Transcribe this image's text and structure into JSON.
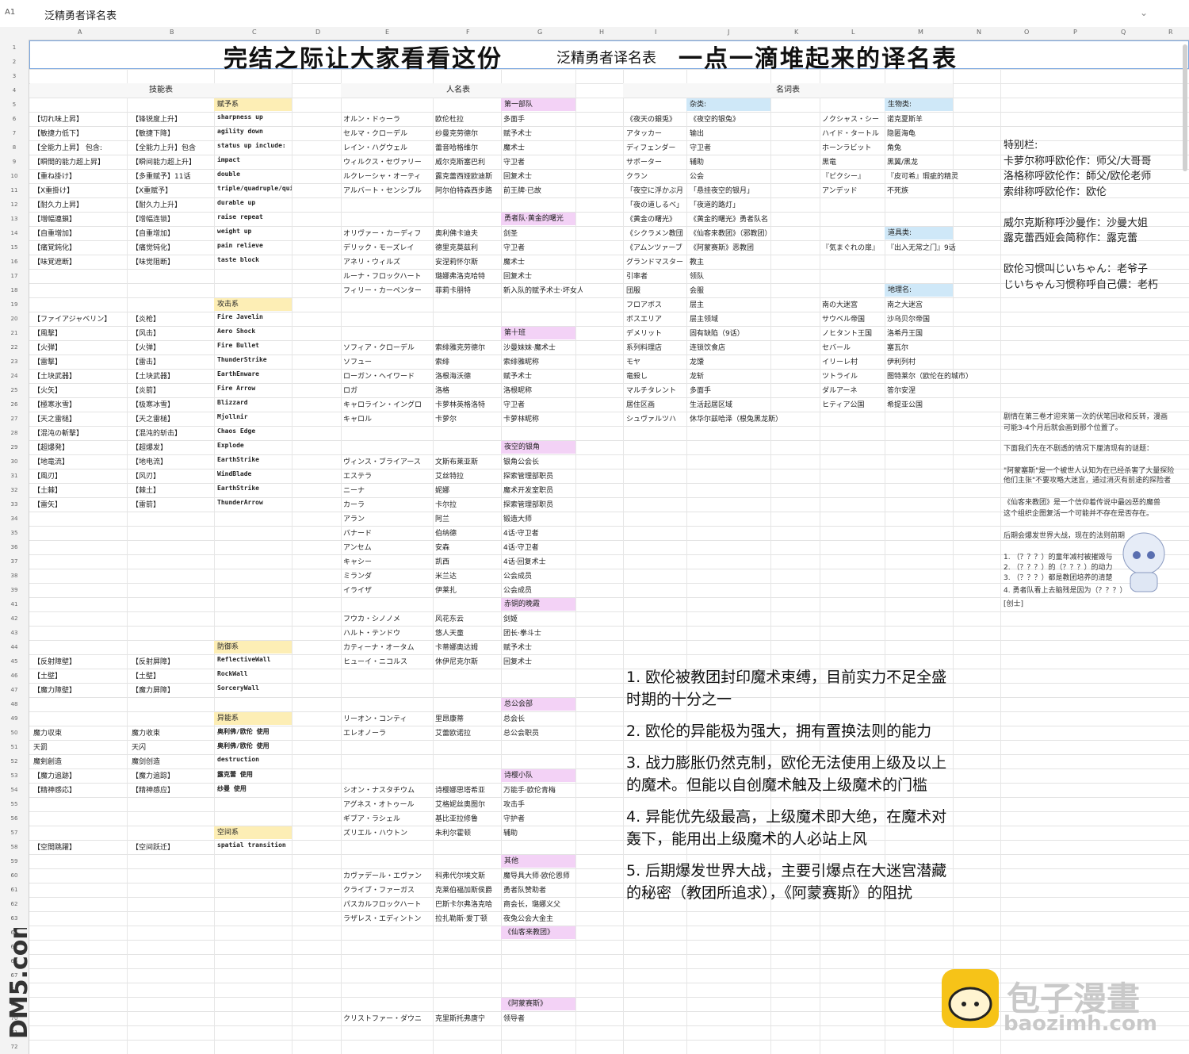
{
  "formula": {
    "cell_ref": "A1",
    "content": "泛精勇者译名表",
    "collapse_icon": "chevron-down-icon"
  },
  "columns": [
    "A",
    "",
    "B",
    "C",
    "D",
    "E",
    "F",
    "G",
    "H",
    "I",
    "J",
    "K",
    "L",
    "M",
    "N",
    "O",
    "P",
    "Q",
    "R"
  ],
  "rows": [
    "1",
    "2",
    "3",
    "4",
    "5",
    "6",
    "7",
    "8",
    "9",
    "10",
    "11",
    "12",
    "13",
    "14",
    "15",
    "16",
    "17",
    "18",
    "19",
    "20",
    "21",
    "22",
    "23",
    "24",
    "25",
    "26",
    "27",
    "28",
    "29",
    "30",
    "31",
    "32",
    "33",
    "34",
    "35",
    "36",
    "37",
    "38",
    "39",
    "41",
    "42",
    "43",
    "44",
    "45",
    "46",
    "47",
    "48",
    "49",
    "50",
    "51",
    "52",
    "53",
    "54",
    "55",
    "56",
    "57",
    "58",
    "59",
    "60",
    "61",
    "62",
    "63",
    "64",
    "65",
    "66",
    "67",
    "68",
    "69",
    "70",
    "71",
    "72"
  ],
  "title": {
    "left": "完结之际让大家看看这份",
    "mid": "泛精勇者译名表",
    "right": "一点一滴堆起来的译名表"
  },
  "sections": {
    "skills": "技能表",
    "names": "人名表",
    "terms": "名词表"
  },
  "skill_groups": {
    "fuyo": "赋予系",
    "attack": "攻击系",
    "defense": "防御系",
    "ability": "异能系",
    "space": "空间系"
  },
  "skills_fuyo": [
    [
      "【切れ味上昇】",
      "【锋锐度上升】",
      "sharpness up"
    ],
    [
      "【敏捷力低下】",
      "【敏捷下降】",
      "agility down"
    ],
    [
      "【全能力上昇】 包含:",
      "【全能力上升】包含",
      "status up include:"
    ],
    [
      "【瞬間的能力超上昇】",
      "【瞬间能力超上升】",
      "impact"
    ],
    [
      "【重ね掛け】",
      "【多重赋予】11话",
      "double"
    ],
    [
      "【X重掛け】",
      "【X重赋予】",
      "triple/quadruple/quintuple"
    ],
    [
      "【耐久力上昇】",
      "【耐久力上升】",
      "durable up"
    ],
    [
      "【増幅連鎖】",
      "【增幅连锁】",
      "raise repeat"
    ],
    [
      "【自重増加】",
      "【自重增加】",
      "weight up"
    ],
    [
      "【痛覚鈍化】",
      "【痛觉钝化】",
      "pain relieve"
    ],
    [
      "【味覚遮断】",
      "【味觉阻断】",
      "taste block"
    ]
  ],
  "skills_attack": [
    [
      "【ファイアジャベリン】",
      "【炎枪】",
      "Fire Javelin"
    ],
    [
      "【風撃】",
      "【风击】",
      "Aero Shock"
    ],
    [
      "【火弾】",
      "【火弹】",
      "Fire Bullet"
    ],
    [
      "【雷撃】",
      "【雷击】",
      "ThunderStrike"
    ],
    [
      "【土块武器】",
      "【土块武器】",
      "EarthEnware"
    ],
    [
      "【火矢】",
      "【炎箭】",
      "Fire Arrow"
    ],
    [
      "【極寒氷雪】",
      "【极寒冰雪】",
      "Blizzard"
    ],
    [
      "【天之雷槌】",
      "【天之雷槌】",
      "Mjollnir"
    ],
    [
      "【混沌の斬撃】",
      "【混沌的斩击】",
      "Chaos Edge"
    ],
    [
      "【超爆発】",
      "【超爆发】",
      "Explode"
    ],
    [
      "【地竜流】",
      "【地电流】",
      "EarthStrike"
    ],
    [
      "【風刃】",
      "【风刃】",
      "WindBlade"
    ],
    [
      "【土棘】",
      "【棘土】",
      "EarthStrike"
    ],
    [
      "【雷矢】",
      "【雷箭】",
      "ThunderArrow"
    ]
  ],
  "skills_defense": [
    [
      "【反射障壁】",
      "【反射屏障】",
      "ReflectiveWall"
    ],
    [
      "【土壁】",
      "【土壁】",
      "RockWall"
    ],
    [
      "【魔力障壁】",
      "【魔力屏障】",
      "SorceryWall"
    ]
  ],
  "skills_ability": [
    [
      "魔力収束",
      "魔力收束",
      "奥利佛/欧伦 使用"
    ],
    [
      "天罰",
      "天闪",
      "奥利佛/欧伦 使用"
    ],
    [
      "魔剣創造",
      "魔剑创造",
      "destruction"
    ],
    [
      "【魔力追跡】",
      "【魔力追踪】",
      "露克蕾 使用"
    ],
    [
      "【精神感応】",
      "【精神感应】",
      "纱曼 使用"
    ]
  ],
  "skills_space": [
    [
      "【空間跳躍】",
      "【空间跃迁】",
      "spatial transition"
    ]
  ],
  "name_groups": {
    "part1": "第一部队",
    "dawn": "勇者队·黄金的曙光",
    "ten": "第十班",
    "night": "夜空的银角",
    "red": "赤铜的晚霞",
    "hq": "总公会部",
    "poem": "诗樱小队",
    "other": "其他",
    "sect": "《仙客来教团》",
    "amon": "《阿蒙赛斯》"
  },
  "names_part1": [
    [
      "オルン・ドゥーラ",
      "欧伦杜拉",
      "多面手"
    ],
    [
      "セルマ・クローデル",
      "纱曼克劳德尔",
      "赋予术士"
    ],
    [
      "レイン・ハグウェル",
      "蕾音哈格维尔",
      "魔术士"
    ],
    [
      "ウィルクス・セヴァリー",
      "威尔克斯塞巴利",
      "守卫者"
    ],
    [
      "ルクレーシャ・オーティ",
      "露克蕾西娅欧迪斯",
      "回复术士"
    ],
    [
      "アルバート・センシブル",
      "阿尔伯特森西步路",
      "前王牌·已故"
    ]
  ],
  "names_dawn": [
    [
      "オリヴァー・カーディフ",
      "奥利佛卡迪夫",
      "剑圣"
    ],
    [
      "デリック・モーズレイ",
      "德里克莫兹利",
      "守卫者"
    ],
    [
      "アネリ・ウィルズ",
      "安涅莉怀尔斯",
      "魔术士"
    ],
    [
      "ルーナ・フロックハート",
      "璐娜弗洛克哈特",
      "回复术士"
    ],
    [
      "フィリー・カーペンター",
      "菲莉卡朋特",
      "新入队的赋予术士·坏女人"
    ]
  ],
  "names_ten": [
    [
      "ソフィア・クローデル",
      "索绯雅克劳德尔",
      "沙曼妹妹·魔术士"
    ],
    [
      "ソフュー",
      "索绯",
      "索绯雅昵称"
    ],
    [
      "ローガン・ヘイワード",
      "洛根海沃德",
      "赋予术士"
    ],
    [
      "ロガ",
      "洛格",
      "洛根昵称"
    ],
    [
      "キャロライン・イングロ",
      "卡萝林英格洛特",
      "守卫者"
    ],
    [
      "キャロル",
      "卡萝尔",
      "卡萝林昵称"
    ]
  ],
  "names_night": [
    [
      "ヴィンス・ブライアース",
      "文斯布莱亚斯",
      "银角公会长"
    ],
    [
      "エステラ",
      "艾丝特拉",
      "探索管理部职员"
    ],
    [
      "ニーナ",
      "妮娜",
      "魔术开发室职员"
    ],
    [
      "カーラ",
      "卡尔拉",
      "探索管理部职员"
    ],
    [
      "アラン",
      "阿兰",
      "锻造大师"
    ],
    [
      "バナード",
      "伯纳德",
      "4话·守卫者"
    ],
    [
      "アンセム",
      "安森",
      "4话·守卫者"
    ],
    [
      "キャシー",
      "凯西",
      "4话·回复术士"
    ],
    [
      "ミランダ",
      "米兰达",
      "公会成员"
    ],
    [
      "イライザ",
      "伊莱扎",
      "公会成员"
    ]
  ],
  "names_red": [
    [
      "フウカ・シノノメ",
      "风花东云",
      "剑姬"
    ],
    [
      "ハルト・テンドウ",
      "悠人天童",
      "团长·拳斗士"
    ],
    [
      "カティーナ・オータム",
      "卡蒂娜奥达姆",
      "赋予术士"
    ],
    [
      "ヒューイ・ニコルス",
      "休伊尼克尔斯",
      "回复术士"
    ]
  ],
  "names_hq": [
    [
      "リーオン・コンティ",
      "里昂康蒂",
      "总会长"
    ],
    [
      "エレオノーラ",
      "艾蕾欧诺拉",
      "总公会职员"
    ]
  ],
  "names_poem": [
    [
      "シオン・ナスタチウム",
      "诗樱娜思塔希亚",
      "万能手·欧伦青梅"
    ],
    [
      "アグネス・オトゥール",
      "艾格妮丝奥图尔",
      "攻击手"
    ],
    [
      "ギブア・ラシェル",
      "基比亚拉修鲁",
      "守护者"
    ],
    [
      "ズリエル・ハウトン",
      "朱利尔霍顿",
      "辅助"
    ]
  ],
  "names_other": [
    [
      "カヴァデール・エヴァン",
      "科弗代尔埃文斯",
      "魔导具大师·欧伦恩师"
    ],
    [
      "クライブ・ファーガス",
      "克莱伯福加斯侯爵",
      "勇者队赞助者"
    ],
    [
      "パスカルフロックハート",
      "巴斯卡尔弗洛克哈",
      "商会长，璐娜义父"
    ],
    [
      "ラザレス・エディントン",
      "拉扎勒斯·爱丁顿",
      "夜兔公会大金主"
    ]
  ],
  "names_amon": [
    [
      "クリストファー・ダウニ",
      "克里斯托弗唐宁",
      "领导者"
    ]
  ],
  "term_groups": {
    "misc": "杂类:",
    "creature": "生物类:",
    "item": "道具类:",
    "place": "地理名:"
  },
  "terms_left": [
    [
      "《夜天の銀兎》",
      "《夜空的银兔》"
    ],
    [
      "アタッカー",
      "输出"
    ],
    [
      "ディフェンダー",
      "守卫者"
    ],
    [
      "サポーター",
      "辅助"
    ],
    [
      "クラン",
      "公会"
    ],
    [
      "「夜空に浮かぶ月",
      "「悬挂夜空的银月」"
    ],
    [
      "「夜の道しるべ」",
      "「夜道的路灯」"
    ],
    [
      "《黄金の曙光》",
      "《黄金的曙光》勇者队名"
    ],
    [
      "《シクラメン教団",
      "《仙客来教团》（邪教团）"
    ],
    [
      "《アムンツァーブ",
      "《阿蒙赛斯》恶教团"
    ],
    [
      "グランドマスター",
      "教主"
    ],
    [
      "引率者",
      "领队"
    ],
    [
      "団服",
      "会服"
    ],
    [
      "フロアボス",
      "层主"
    ],
    [
      "ボスエリア",
      "层主领域"
    ],
    [
      "デメリット",
      "固有缺陷（9话）"
    ],
    [
      "系列料理店",
      "连锁饮食店"
    ],
    [
      "モヤ",
      "龙馕"
    ],
    [
      "竜殺し",
      "龙斩"
    ],
    [
      "マルチタレント",
      "多面手"
    ],
    [
      "居住区画",
      "生活起居区域"
    ],
    [
      "シュヴァルツハ",
      "休华尔兹哈泽（根兔黑龙斯）"
    ]
  ],
  "terms_creature": [
    [
      "ノクシャス・シー",
      "诺克夏斯羊"
    ],
    [
      "ハイド・タートル",
      "隐匿海龟"
    ],
    [
      "ホーンラビット",
      "角兔"
    ],
    [
      "黒竜",
      "黑翼/黑龙"
    ],
    [
      "『ピクシー』",
      "『皮可希』瑕疵的精灵"
    ],
    [
      "アンデッド",
      "不死族"
    ]
  ],
  "terms_item": [
    [
      "『気まぐれの扉』",
      "『出入无常之门』9话"
    ]
  ],
  "terms_place": [
    [
      "南の大迷宮",
      "南之大迷宫"
    ],
    [
      "サウベル帝国",
      "沙乌贝尔帝国"
    ],
    [
      "ノヒタント王国",
      "洛希丹王国"
    ],
    [
      "セバール",
      "塞瓦尔"
    ],
    [
      "イリーレ村",
      "伊利列村"
    ],
    [
      "ツトライル",
      "图特莱尔（欧伦在的城市）"
    ],
    [
      "ダルアーネ",
      "答尔安涅"
    ],
    [
      "ヒティア公国",
      "希提亚公国"
    ]
  ],
  "special_notes": [
    "特别栏:",
    "卡萝尔称呼欧伦作：师父/大哥哥",
    "洛格称呼欧伦作：師父/欧伦老师",
    "索绯称呼欧伦作：欧伦",
    "",
    "威尔克斯称呼沙曼作：沙曼大姐",
    "露克蕾西娅会简称作：露克蕾",
    "",
    "欧伦习惯叫じいちゃん：老爷子",
    "じいちゃん习惯称呼自己儂：老朽"
  ],
  "plot_notes": [
    "剧情在第三卷才迎来第一次的伏笔回收和反转，漫画",
    "可能3-4个月后就会画到那个位置了。",
    "下面我们先在不剧透的情况下厘清现有的谜题：",
    "\"阿蒙塞斯\"是一个被世人认知为在已经杀害了大量探险",
    "他们主张\"不要攻略大迷宫，通过消灭有前途的探险者",
    "《仙客来教团》是一个信仰着传说中最凶恶的魔兽",
    "这个组织企图复活一个可能并不存在是否存在。",
    "后期会爆发世界大战，现在的法则前期",
    "1. （？？？）的童年减村被摧毁与",
    "2. （？？？）的（？？？）的动力",
    "3. （？？？）都是教团培养的清楚",
    "4. 勇者队看上去脑残是因为（？？？）",
    "[创士]"
  ],
  "big_notes": [
    "1. 欧伦被教团封印魔术束缚，目前实力不足全盛时期的十分之一",
    "2. 欧伦的异能极为强大，拥有置换法则的能力",
    "3. 战力膨胀仍然克制，欧伦无法使用上级及以上的魔术。但能以自创魔术触及上级魔术的门槛",
    "4. 异能优先级最高，上级魔术即大绝，在魔术对轰下，能用出上级魔术的人必站上风",
    "5. 后期爆发世界大战，主要引爆点在大迷宫潜藏的秘密（教团所追求），《阿蒙赛斯》的阻扰"
  ],
  "watermark": {
    "left": "DM5.com",
    "right_cn": "包子漫畫",
    "right_url": "baozimh.com"
  }
}
